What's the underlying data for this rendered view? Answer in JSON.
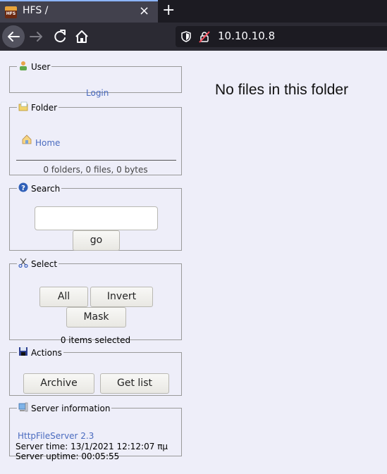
{
  "browser": {
    "tab_title": "HFS /",
    "tab_close": "×",
    "new_tab": "+",
    "favicon_text": "HFS",
    "url": "10.10.10.8"
  },
  "user_panel": {
    "legend": "User",
    "login_label": "Login"
  },
  "folder_panel": {
    "legend": "Folder",
    "home_label": "Home",
    "stats": "0 folders, 0 files, 0 bytes"
  },
  "search_panel": {
    "legend": "Search",
    "input_value": "",
    "go_label": "go"
  },
  "select_panel": {
    "legend": "Select",
    "all_label": "All",
    "invert_label": "Invert",
    "mask_label": "Mask",
    "status": "0 items selected"
  },
  "actions_panel": {
    "legend": "Actions",
    "archive_label": "Archive",
    "get_list_label": "Get list"
  },
  "server_panel": {
    "legend": "Server information",
    "hfs_link": "HttpFileServer 2.3",
    "server_time": "Server time: 13/1/2021 12:12:07 πμ",
    "server_uptime": "Server uptime: 00:05:55"
  },
  "main": {
    "empty_message": "No files in this folder"
  },
  "colors": {
    "page_bg": "#eeeef9",
    "link": "#4a6bbf",
    "chrome_bg": "#1c1b22",
    "tab_accent": "#8cb4ff"
  }
}
